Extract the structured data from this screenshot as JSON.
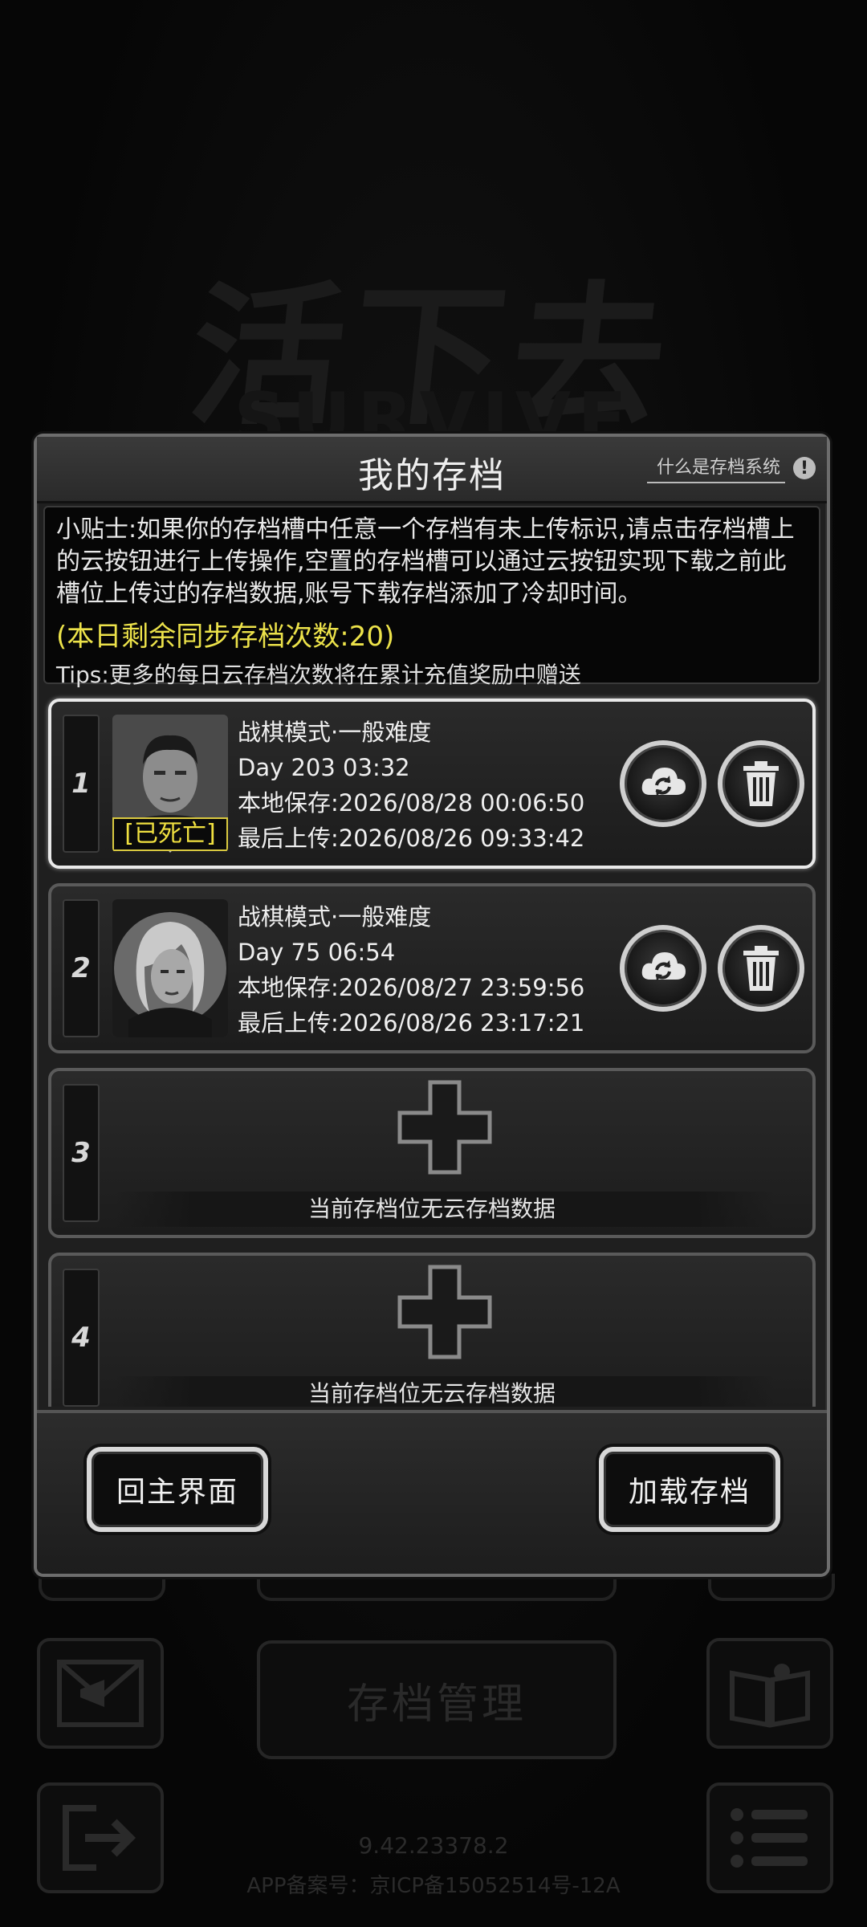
{
  "background": {
    "logo_text": "活下去",
    "logo_sub": "SURVIVE",
    "center_button_label": "存档管理",
    "version": "9.42.23378.2",
    "icp": "APP备案号：京ICP备15052514号-12A"
  },
  "dialog": {
    "title": "我的存档",
    "help_link": "什么是存档系统",
    "help_icon_glyph": "!",
    "tips": {
      "main": "小贴士:如果你的存档槽中任意一个存档有未上传标识,请点击存档槽上的云按钮进行上传操作,空置的存档槽可以通过云按钮实现下载之前此槽位上传过的存档数据,账号下载存档添加了冷却时间。",
      "sync_count": "(本日剩余同步存档次数:20)",
      "extra": "Tips:更多的每日云存档次数将在累计充值奖励中赠送"
    },
    "slots": [
      {
        "number": "1",
        "mode": "战棋模式·一般难度",
        "day": "Day 203  03:32",
        "local_save": "本地保存:2026/08/28  00:06:50",
        "last_upload": "最后上传:2026/08/26  09:33:42",
        "status_badge": "[已死亡]",
        "selected": true
      },
      {
        "number": "2",
        "mode": "战棋模式·一般难度",
        "day": "Day 75  06:54",
        "local_save": "本地保存:2026/08/27  23:59:56",
        "last_upload": "最后上传:2026/08/26  23:17:21",
        "selected": false
      },
      {
        "number": "3",
        "empty_text": "当前存档位无云存档数据"
      },
      {
        "number": "4",
        "empty_text": "当前存档位无云存档数据"
      }
    ],
    "buttons": {
      "back": "回主界面",
      "load": "加载存档"
    }
  }
}
